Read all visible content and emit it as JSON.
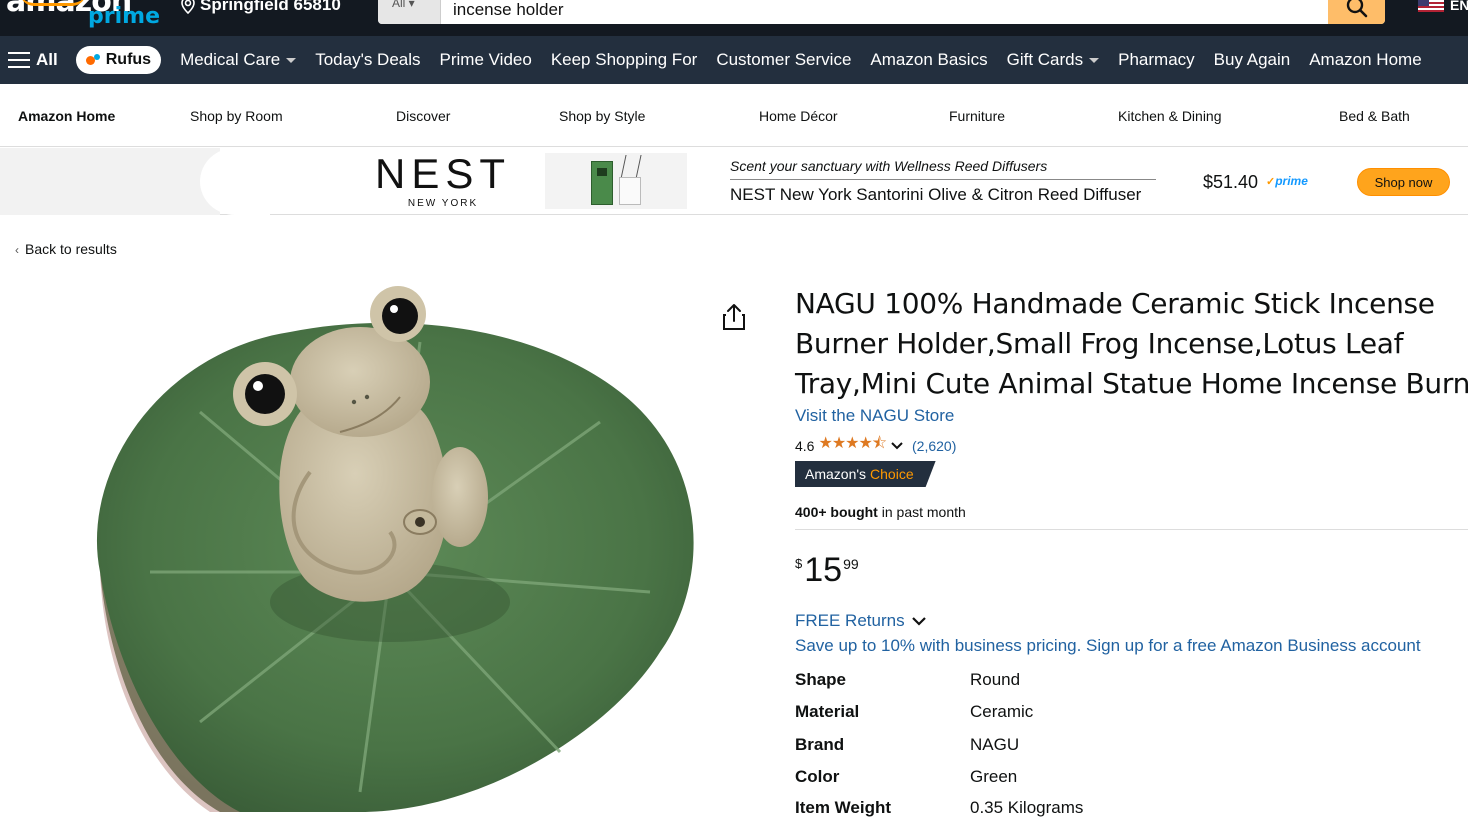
{
  "header": {
    "logo_text": "amazon",
    "logo_sub": "prime",
    "location": "Springfield 65810",
    "search_category": "All",
    "search_value": "incense holder",
    "language": "EN"
  },
  "nav": {
    "all_label": "All",
    "rufus_label": "Rufus",
    "items": [
      {
        "label": "Medical Care",
        "dropdown": true
      },
      {
        "label": "Today's Deals"
      },
      {
        "label": "Prime Video"
      },
      {
        "label": "Keep Shopping For"
      },
      {
        "label": "Customer Service"
      },
      {
        "label": "Amazon Basics"
      },
      {
        "label": "Gift Cards",
        "dropdown": true
      },
      {
        "label": "Pharmacy"
      },
      {
        "label": "Buy Again"
      },
      {
        "label": "Amazon Home"
      }
    ]
  },
  "subnav": {
    "items": [
      "Amazon Home",
      "Shop by Room",
      "Discover",
      "Shop by Style",
      "Home Décor",
      "Furniture",
      "Kitchen & Dining",
      "Bed & Bath"
    ]
  },
  "ad": {
    "brand": "NEST",
    "brand_sub": "NEW YORK",
    "tagline": "Scent your sanctuary with Wellness Reed Diffusers",
    "product": "NEST New York Santorini Olive & Citron Reed Diffuser",
    "price": "$51.40",
    "prime": "prime",
    "cta": "Shop now"
  },
  "back_label": "Back to results",
  "product": {
    "title_lines": [
      "NAGU 100% Handmade Ceramic Stick Incense",
      "Burner Holder,Small Frog Incense,Lotus Leaf",
      "Tray,Mini Cute Animal Statue Home Incense Burner"
    ],
    "store_link": "Visit the NAGU Store",
    "rating": "4.6",
    "rating_value": 4.6,
    "rating_count": "(2,620)",
    "badge_prefix": "Amazon's",
    "badge_suffix": "Choice",
    "bought_bold": "400+ bought",
    "bought_rest": " in past month",
    "price_symbol": "$",
    "price_whole": "15",
    "price_fraction": "99",
    "returns": "FREE Returns",
    "business": "Save up to 10% with business pricing. Sign up for a free Amazon Business account",
    "specs": [
      {
        "key": "Shape",
        "value": "Round"
      },
      {
        "key": "Material",
        "value": "Ceramic"
      },
      {
        "key": "Brand",
        "value": "NAGU"
      },
      {
        "key": "Color",
        "value": "Green"
      },
      {
        "key": "Item Weight",
        "value": "0.35 Kilograms"
      }
    ]
  },
  "colors": {
    "header_bg": "#131921",
    "nav_bg": "#232f3e",
    "link": "#2162a1",
    "star": "#de7921",
    "cta": "#ffa41c",
    "leaf": "#4e7a4a"
  }
}
